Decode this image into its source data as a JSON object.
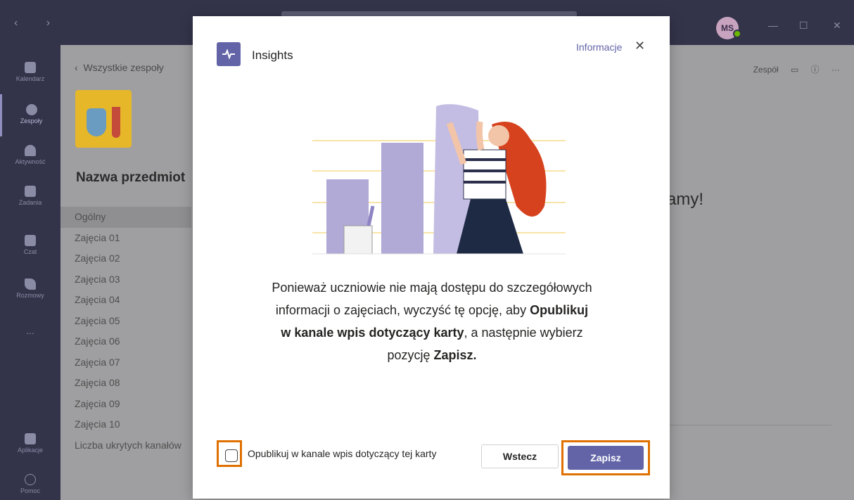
{
  "titlebar": {
    "nav_arrows": "‹  ›",
    "avatar_initials": "MS",
    "minimize": "—",
    "maximize": "☐",
    "close": "✕"
  },
  "rail": {
    "items": [
      {
        "label": "Kalendarz",
        "icon": "calendar-icon"
      },
      {
        "label": "Zespoły",
        "icon": "teams-icon"
      },
      {
        "label": "Aktywność",
        "icon": "bell-icon"
      },
      {
        "label": "Zadania",
        "icon": "bag-icon"
      },
      {
        "label": "Czat",
        "icon": "chat-icon"
      },
      {
        "label": "Rozmowy",
        "icon": "phone-icon"
      },
      {
        "label": "...",
        "icon": "more-icon"
      }
    ],
    "apps_label": "Aplikacje",
    "help_label": "Pomoc"
  },
  "team": {
    "back_label": "Wszystkie zespoły",
    "name": "Nazwa przedmiot",
    "channels": [
      "Ogólny",
      "Zajęcia 01",
      "Zajęcia 02",
      "Zajęcia 03",
      "Zajęcia 04",
      "Zajęcia 05",
      "Zajęcia 06",
      "Zajęcia 07",
      "Zajęcia 08",
      "Zajęcia 09",
      "Zajęcia 10",
      "Liczba ukrytych kanałów"
    ],
    "team_badge": "Zespół",
    "welcome_partial": "amy!"
  },
  "dialog": {
    "app_name": "Insights",
    "info_link": "Informacje",
    "close_glyph": "✕",
    "body_part1": "Ponieważ uczniowie nie mają dostępu do szczegółowych informacji o zajęciach, wyczyść tę opcję, aby ",
    "body_bold1": "Opublikuj w kanale wpis dotyczący karty",
    "body_part2": ", a następnie wybierz pozycję ",
    "body_bold2": "Zapisz.",
    "checkbox_label": "Opublikuj w kanale wpis dotyczący tej karty",
    "checkbox_checked": false,
    "back_button": "Wstecz",
    "save_button": "Zapisz"
  },
  "colors": {
    "accent": "#6264a7",
    "highlight": "#e07000",
    "rail_bg": "#33344a"
  }
}
